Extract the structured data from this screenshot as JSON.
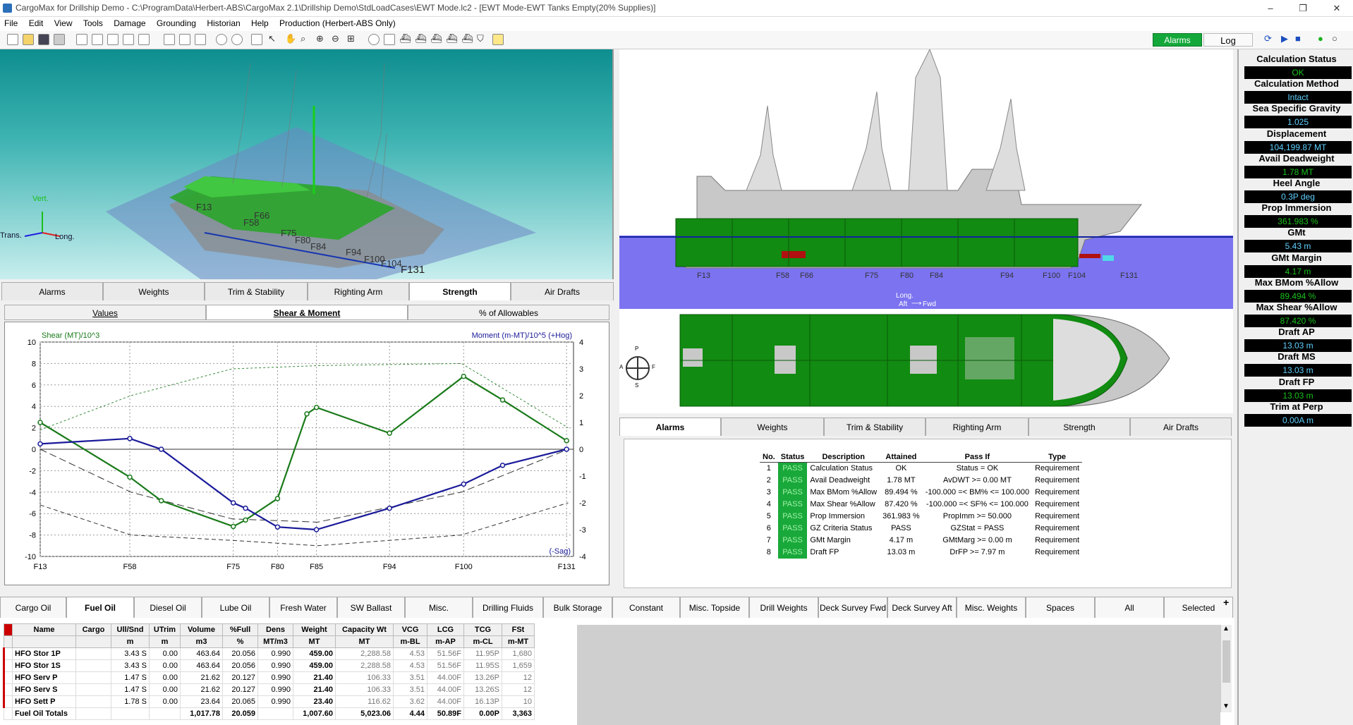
{
  "window": {
    "title": "CargoMax for Drillship Demo - C:\\ProgramData\\Herbert-ABS\\CargoMax 2.1\\Drillship Demo\\StdLoadCases\\EWT Mode.lc2 - [EWT Mode-EWT Tanks Empty(20% Supplies)]",
    "minimize": "–",
    "restore": "❐",
    "close": "✕"
  },
  "menu": [
    "File",
    "Edit",
    "View",
    "Tools",
    "Damage",
    "Grounding",
    "Historian",
    "Help",
    "Production (Herbert-ABS Only)"
  ],
  "toolbar": {
    "alarms_label": "Alarms",
    "log_label": "Log"
  },
  "view3d": {
    "axis_vert": "Vert.",
    "axis_trans": "Trans.",
    "axis_long": "Long.",
    "frame_labels": [
      "F13",
      "F58",
      "F66",
      "F75",
      "F80",
      "F84",
      "F94",
      "F100",
      "F104",
      "F131"
    ]
  },
  "left_tabs": [
    "Alarms",
    "Weights",
    "Trim & Stability",
    "Righting Arm",
    "Strength",
    "Air Drafts"
  ],
  "left_active_tab": "Strength",
  "strength_subtabs": [
    "Values",
    "Shear & Moment",
    "% of Allowables"
  ],
  "strength_active_subtab": "Shear & Moment",
  "chart_data": {
    "type": "line",
    "left_axis_label": "Shear (MT)/10^3",
    "right_axis_label": "Moment (m-MT)/10^5 (+Hog)",
    "sag_label": "(-Sag)",
    "left_ylim": [
      -10,
      10
    ],
    "right_ylim": [
      -4,
      4
    ],
    "left_ticks": [
      10,
      8,
      6,
      4,
      2,
      0,
      -2,
      -4,
      -6,
      -8,
      -10
    ],
    "right_ticks": [
      4,
      3,
      2,
      1,
      0,
      -1,
      -2,
      -3,
      -4
    ],
    "x_ticks": [
      {
        "label": "F13",
        "x": 0.0
      },
      {
        "label": "F58",
        "x": 0.168
      },
      {
        "label": "F75",
        "x": 0.362
      },
      {
        "label": "F80",
        "x": 0.445
      },
      {
        "label": "F85",
        "x": 0.518
      },
      {
        "label": "F94",
        "x": 0.655
      },
      {
        "label": "F100",
        "x": 0.794
      },
      {
        "label": "F131",
        "x": 0.987
      }
    ],
    "grid": true,
    "series": [
      {
        "name": "Shear",
        "color": "#1a7a1a",
        "axis": "left",
        "points": [
          [
            0.0,
            2.5
          ],
          [
            0.168,
            -2.6
          ],
          [
            0.227,
            -4.8
          ],
          [
            0.362,
            -7.2
          ],
          [
            0.385,
            -6.6
          ],
          [
            0.445,
            -4.6
          ],
          [
            0.5,
            3.3
          ],
          [
            0.518,
            3.9
          ],
          [
            0.655,
            1.5
          ],
          [
            0.794,
            6.8
          ],
          [
            0.867,
            4.6
          ],
          [
            0.987,
            0.8
          ]
        ]
      },
      {
        "name": "Moment",
        "color": "#1a1a9a",
        "axis": "right",
        "points": [
          [
            0.0,
            0.2
          ],
          [
            0.168,
            0.4
          ],
          [
            0.227,
            0.0
          ],
          [
            0.362,
            -2.0
          ],
          [
            0.385,
            -2.2
          ],
          [
            0.445,
            -2.9
          ],
          [
            0.518,
            -3.0
          ],
          [
            0.655,
            -2.2
          ],
          [
            0.794,
            -1.3
          ],
          [
            0.867,
            -0.6
          ],
          [
            0.987,
            0.0
          ]
        ]
      }
    ]
  },
  "profile": {
    "frame_labels": [
      "F13",
      "F58",
      "F66",
      "F75",
      "F80",
      "F84",
      "F94",
      "F100",
      "F104",
      "F131"
    ],
    "axis_label": "Long.",
    "aft": "Aft",
    "fwd": "Fwd",
    "water_color": "#7b73f0",
    "hull_green": "#118b11"
  },
  "compass": {
    "p": "P",
    "s": "S",
    "a": "A",
    "f": "F"
  },
  "right_tabs": [
    "Alarms",
    "Weights",
    "Trim & Stability",
    "Righting Arm",
    "Strength",
    "Air Drafts"
  ],
  "right_active_tab": "Alarms",
  "alarms": {
    "headers": [
      "No.",
      "Status",
      "Description",
      "Attained",
      "Pass If",
      "Type"
    ],
    "rows": [
      {
        "no": "1",
        "status": "PASS",
        "desc": "Calculation Status",
        "attained": "OK",
        "pass_if": "Status = OK",
        "type": "Requirement"
      },
      {
        "no": "2",
        "status": "PASS",
        "desc": "Avail Deadweight",
        "attained": "1.78 MT",
        "pass_if": "AvDWT >= 0.00 MT",
        "type": "Requirement"
      },
      {
        "no": "3",
        "status": "PASS",
        "desc": "Max BMom %Allow",
        "attained": "89.494 %",
        "pass_if": "-100.000 =< BM% <= 100.000",
        "type": "Requirement"
      },
      {
        "no": "4",
        "status": "PASS",
        "desc": "Max Shear %Allow",
        "attained": "87.420 %",
        "pass_if": "-100.000 =< SF% <= 100.000",
        "type": "Requirement"
      },
      {
        "no": "5",
        "status": "PASS",
        "desc": "Prop Immersion",
        "attained": "361.983 %",
        "pass_if": "PropImm >= 50.000",
        "type": "Requirement"
      },
      {
        "no": "6",
        "status": "PASS",
        "desc": "GZ Criteria Status",
        "attained": "PASS",
        "pass_if": "GZStat = PASS",
        "type": "Requirement"
      },
      {
        "no": "7",
        "status": "PASS",
        "desc": "GMt Margin",
        "attained": "4.17 m",
        "pass_if": "GMtMarg >= 0.00 m",
        "type": "Requirement"
      },
      {
        "no": "8",
        "status": "PASS",
        "desc": "Draft FP",
        "attained": "13.03 m",
        "pass_if": "DrFP >= 7.97 m",
        "type": "Requirement"
      }
    ]
  },
  "status_panel": [
    {
      "label": "Calculation Status",
      "value": "OK",
      "color": "#19c21c"
    },
    {
      "label": "Calculation Method",
      "value": "Intact",
      "color": "#5fd0ff"
    },
    {
      "label": "Sea Specific Gravity",
      "value": "1.025",
      "color": "#5fd0ff"
    },
    {
      "label": "Displacement",
      "value": "104,199.87 MT",
      "color": "#5fd0ff"
    },
    {
      "label": "Avail Deadweight",
      "value": "1.78 MT",
      "color": "#19c21c"
    },
    {
      "label": "Heel Angle",
      "value": "0.3P deg",
      "color": "#5fd0ff"
    },
    {
      "label": "Prop Immersion",
      "value": "361.983 %",
      "color": "#19c21c"
    },
    {
      "label": "GMt",
      "value": "5.43 m",
      "color": "#5fd0ff"
    },
    {
      "label": "GMt Margin",
      "value": "4.17 m",
      "color": "#19c21c"
    },
    {
      "label": "Max BMom %Allow",
      "value": "89.494 %",
      "color": "#19c21c"
    },
    {
      "label": "Max Shear %Allow",
      "value": "87.420 %",
      "color": "#19c21c"
    },
    {
      "label": "Draft AP",
      "value": "13.03 m",
      "color": "#5fd0ff"
    },
    {
      "label": "Draft MS",
      "value": "13.03 m",
      "color": "#5fd0ff"
    },
    {
      "label": "Draft FP",
      "value": "13.03 m",
      "color": "#19c21c"
    },
    {
      "label": "Trim at Perp",
      "value": "0.00A m",
      "color": "#5fd0ff"
    }
  ],
  "bottom_tabs": [
    "Cargo Oil",
    "Fuel Oil",
    "Diesel Oil",
    "Lube Oil",
    "Fresh Water",
    "SW Ballast",
    "Misc.",
    "Drilling Fluids",
    "Bulk Storage",
    "Constant",
    "Misc. Topside",
    "Drill Weights",
    "Deck Survey Fwd",
    "Deck Survey Aft",
    "Misc. Weights",
    "Spaces",
    "All",
    "Selected"
  ],
  "bottom_active_tab": "Fuel Oil",
  "add_tab": "+",
  "grid": {
    "headers": [
      "Name",
      "Cargo",
      "Ull/Snd",
      "UTrim",
      "Volume",
      "%Full",
      "Dens",
      "Weight",
      "Capacity Wt",
      "VCG",
      "LCG",
      "TCG",
      "FSt"
    ],
    "units": [
      "",
      "",
      "m",
      "m",
      "m3",
      "%",
      "MT/m3",
      "MT",
      "MT",
      "m-BL",
      "m-AP",
      "m-CL",
      "m-MT"
    ],
    "rows": [
      [
        "HFO Stor 1P",
        "",
        "3.43 S",
        "0.00",
        "463.64",
        "20.056",
        "0.990",
        "459.00",
        "2,288.58",
        "4.53",
        "51.56F",
        "11.95P",
        "1,680"
      ],
      [
        "HFO Stor 1S",
        "",
        "3.43 S",
        "0.00",
        "463.64",
        "20.056",
        "0.990",
        "459.00",
        "2,288.58",
        "4.53",
        "51.56F",
        "11.95S",
        "1,659"
      ],
      [
        "HFO Serv P",
        "",
        "1.47 S",
        "0.00",
        "21.62",
        "20.127",
        "0.990",
        "21.40",
        "106.33",
        "3.51",
        "44.00F",
        "13.26P",
        "12"
      ],
      [
        "HFO Serv S",
        "",
        "1.47 S",
        "0.00",
        "21.62",
        "20.127",
        "0.990",
        "21.40",
        "106.33",
        "3.51",
        "44.00F",
        "13.26S",
        "12"
      ],
      [
        "HFO Sett P",
        "",
        "1.78 S",
        "0.00",
        "23.64",
        "20.065",
        "0.990",
        "23.40",
        "116.62",
        "3.62",
        "44.00F",
        "16.13P",
        "10"
      ]
    ],
    "totals": [
      "Fuel Oil Totals",
      "",
      "",
      "",
      "1,017.78",
      "20.059",
      "",
      "1,007.60",
      "5,023.06",
      "4.44",
      "50.89F",
      "0.00P",
      "3,363"
    ]
  }
}
